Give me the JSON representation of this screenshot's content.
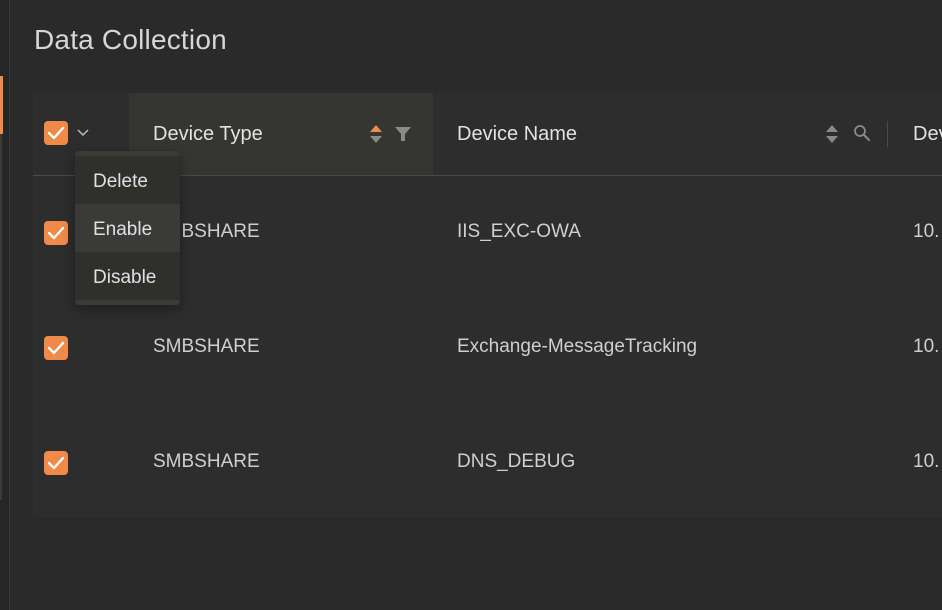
{
  "page": {
    "title": "Data Collection"
  },
  "table": {
    "columns": [
      {
        "key": "device_type",
        "label": "Device Type"
      },
      {
        "key": "device_name",
        "label": "Device Name"
      },
      {
        "key": "device_ip",
        "label": "Dev"
      }
    ],
    "rows": [
      {
        "checked": true,
        "device_type": "SMBSHARE",
        "device_name": "IIS_EXC-OWA",
        "device_ip": "10."
      },
      {
        "checked": true,
        "device_type": "SMBSHARE",
        "device_name": "Exchange-MessageTracking",
        "device_ip": "10."
      },
      {
        "checked": true,
        "device_type": "SMBSHARE",
        "device_name": "DNS_DEBUG",
        "device_ip": "10."
      }
    ]
  },
  "bulk_menu": {
    "items": [
      "Delete",
      "Enable",
      "Disable"
    ]
  },
  "colors": {
    "accent": "#f08a4b",
    "background": "#2a2a2a",
    "header_active": "#353532"
  },
  "icons": [
    "check-icon",
    "chevron-down-icon",
    "sort-icon",
    "filter-icon",
    "search-icon"
  ]
}
